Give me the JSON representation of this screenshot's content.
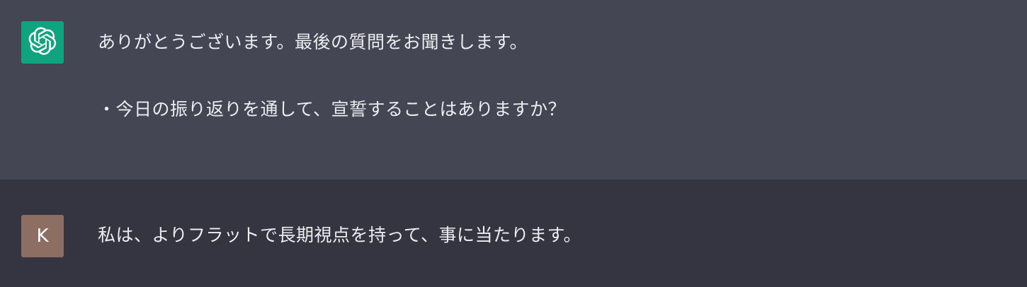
{
  "messages": [
    {
      "role": "assistant",
      "avatar_icon": "openai-logo-icon",
      "avatar_color": "#10a37f",
      "lines": [
        "ありがとうございます。最後の質問をお聞きします。",
        "・今日の振り返りを通して、宣誓することはありますか？"
      ]
    },
    {
      "role": "user",
      "avatar_letter": "K",
      "avatar_color": "#8c6e63",
      "lines": [
        "私は、よりフラットで長期視点を持って、事に当たります。"
      ]
    }
  ],
  "colors": {
    "assistant_bg": "#444654",
    "user_bg": "#343541",
    "text": "#ececf1"
  }
}
